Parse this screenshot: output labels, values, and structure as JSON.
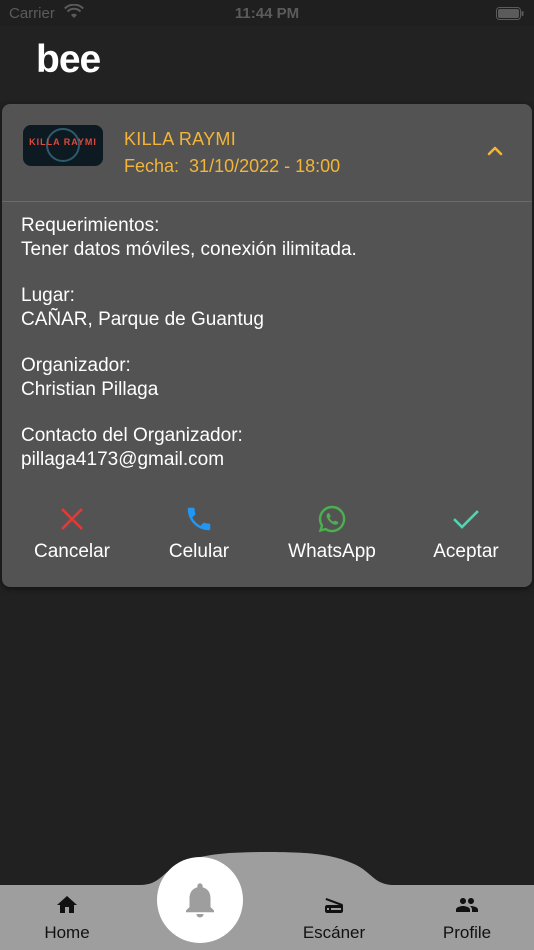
{
  "status_bar": {
    "carrier": "Carrier",
    "time": "11:44 PM"
  },
  "app": {
    "logo": "bee"
  },
  "event": {
    "thumbnail_text": "KILLA RAYMI",
    "title": "KILLA RAYMI",
    "date_label": "Fecha:",
    "date_value": "31/10/2022 - 18:00",
    "details": [
      {
        "label": "Requerimientos:",
        "value": "Tener datos móviles, conexión ilimitada."
      },
      {
        "label": "Lugar:",
        "value": "CAÑAR, Parque de Guantug"
      },
      {
        "label": "Organizador:",
        "value": "Christian Pillaga"
      },
      {
        "label": "Contacto del Organizador:",
        "value": "pillaga4173@gmail.com"
      }
    ]
  },
  "actions": {
    "cancel": {
      "label": "Cancelar",
      "icon": "close-icon",
      "color": "#e53935"
    },
    "phone": {
      "label": "Celular",
      "icon": "phone-icon",
      "color": "#2196f3"
    },
    "whatsapp": {
      "label": "WhatsApp",
      "icon": "whatsapp-icon",
      "color": "#4caf50"
    },
    "accept": {
      "label": "Aceptar",
      "icon": "check-icon",
      "color": "#4fd6b0"
    }
  },
  "bottom_nav": {
    "home": {
      "label": "Home",
      "icon": "home-icon"
    },
    "center": {
      "icon": "bell-icon"
    },
    "scanner": {
      "label": "Escáner",
      "icon": "scanner-icon"
    },
    "profile": {
      "label": "Profile",
      "icon": "people-icon"
    }
  },
  "colors": {
    "accent": "#f2b53a",
    "card": "#535353",
    "background": "#212121",
    "nav": "#9e9e9e"
  }
}
